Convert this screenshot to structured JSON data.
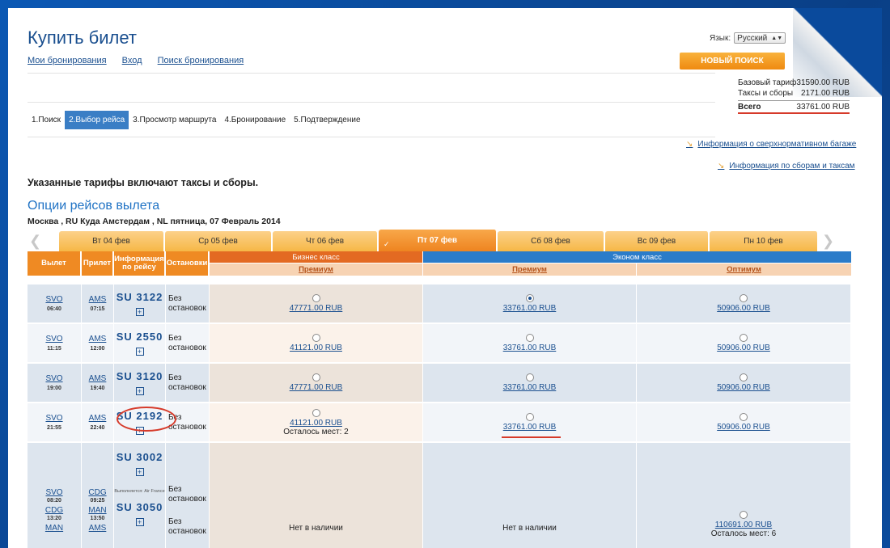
{
  "page_title": "Купить билет",
  "top_links": [
    "Мои бронирования",
    "Вход",
    "Поиск бронирования"
  ],
  "language": {
    "label": "Язык:",
    "value": "Русский"
  },
  "new_search_label": "НОВЫЙ ПОИСК",
  "fare_summary": {
    "base_label": "Базовый тариф",
    "base_value": "31590.00 RUB",
    "taxes_label": "Таксы и сборы",
    "taxes_value": "2171.00 RUB",
    "total_label": "Всего",
    "total_value": "33761.00 RUB"
  },
  "steps": [
    "1.Поиск",
    "2.Выбор рейса",
    "3.Просмотр маршрута",
    "4.Бронирование",
    "5.Подтверждение"
  ],
  "info_links": [
    "Информация о сверхнормативном багаже",
    "Информация по сборам и таксам"
  ],
  "notice": "Указанные тарифы включают таксы и сборы.",
  "section_title": "Опции рейсов вылета",
  "route": "Москва , RU Куда Амстердам , NL пятница, 07 Февраль 2014",
  "days": [
    "Вт 04 фев",
    "Ср 05 фев",
    "Чт 06 фев",
    "Пт 07 фев",
    "Сб 08 фев",
    "Вс 09 фев",
    "Пн 10 фев"
  ],
  "active_day": 3,
  "headers": {
    "dep": "Вылет",
    "arr": "Прилет",
    "info": "Информация по рейсу",
    "stops": "Остановки",
    "business": "Бизнес класс",
    "economy": "Эконом класс",
    "premium": "Премиум",
    "premium2": "Премиум",
    "optimum": "Оптимум"
  },
  "rows": [
    {
      "dep": "SVO",
      "dep_time": "06:40",
      "arr": "AMS",
      "arr_time": "07:15",
      "flight": "SU  3122",
      "stops": "Без остановок",
      "business": "47771.00 RUB",
      "premium": "33761.00 RUB",
      "optimum": "50906.00 RUB"
    },
    {
      "dep": "SVO",
      "dep_time": "11:15",
      "arr": "AMS",
      "arr_time": "12:00",
      "flight": "SU  2550",
      "stops": "Без остановок",
      "business": "41121.00 RUB",
      "premium": "33761.00 RUB",
      "optimum": "50906.00 RUB"
    },
    {
      "dep": "SVO",
      "dep_time": "19:00",
      "arr": "AMS",
      "arr_time": "19:40",
      "flight": "SU  3120",
      "stops": "Без остановок",
      "business": "47771.00 RUB",
      "premium": "33761.00 RUB",
      "optimum": "50906.00 RUB"
    },
    {
      "dep": "SVO",
      "dep_time": "21:55",
      "arr": "AMS",
      "arr_time": "22:40",
      "flight": "SU  2192",
      "stops": "Без остановок",
      "business": "41121.00 RUB",
      "business_seats": "Осталось мест: 2",
      "premium": "33761.00 RUB",
      "optimum": "50906.00 RUB"
    }
  ],
  "multi_row": {
    "deps": [
      {
        "code": "SVO",
        "time": "08:20"
      },
      {
        "code": "CDG",
        "time": "13:20"
      },
      {
        "code": "MAN",
        "time": ""
      }
    ],
    "arrs": [
      {
        "code": "CDG",
        "time": "09:25"
      },
      {
        "code": "MAN",
        "time": "13:50"
      },
      {
        "code": "AMS",
        "time": ""
      }
    ],
    "flight1": "SU  3002",
    "operated_by": "Выполняется: Air France",
    "flight2": "SU  3050",
    "stops": "Без остановок",
    "stops2": "Без остановок",
    "business": "Нет в наличии",
    "premium": "Нет в наличии",
    "optimum": "110691.00 RUB",
    "optimum_seats": "Осталось мест: 6"
  }
}
